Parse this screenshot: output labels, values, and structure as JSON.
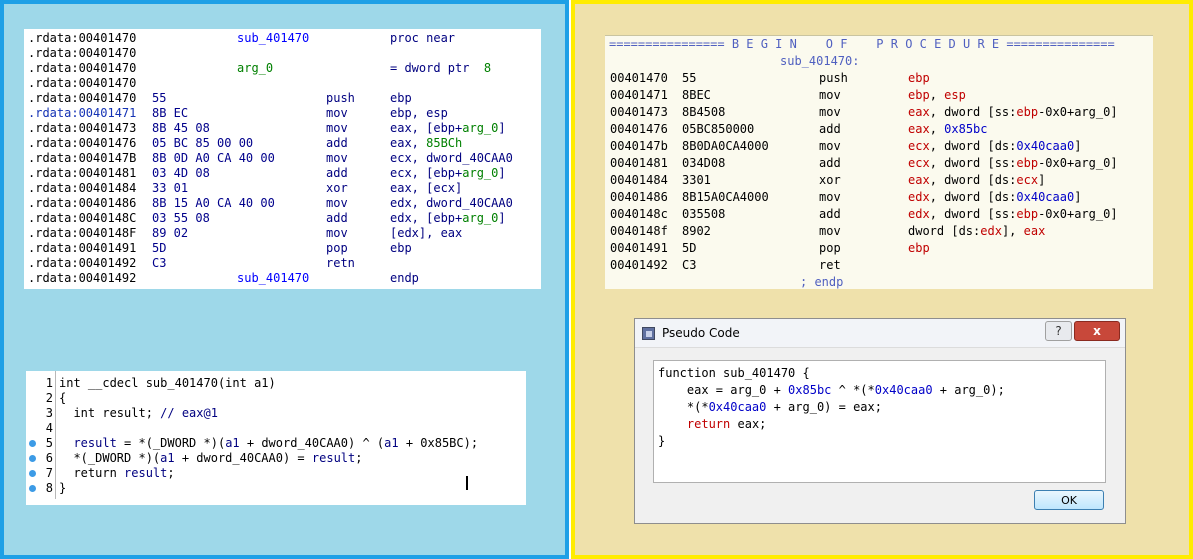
{
  "ida_listing": [
    {
      "addr": ".rdata:00401470",
      "bytes": "",
      "name": "sub_401470",
      "dir": "proc near",
      "mnem": "",
      "ops": []
    },
    {
      "addr": ".rdata:00401470",
      "bytes": "",
      "name": "",
      "dir": "",
      "mnem": "",
      "ops": []
    },
    {
      "addr": ".rdata:00401470",
      "bytes": "",
      "argname": "arg_0",
      "dirops": "= dword ptr  ",
      "dirval": "8"
    },
    {
      "addr": ".rdata:00401470",
      "bytes": "",
      "name": "",
      "dir": "",
      "mnem": "",
      "ops": []
    },
    {
      "addr": ".rdata:00401470",
      "bytes": "55",
      "mnem": "push",
      "ops": [
        {
          "t": "ebp"
        }
      ]
    },
    {
      "addr": ".rdata:00401471",
      "bytes": "8B EC",
      "hl": true,
      "mnem": "mov",
      "ops": [
        {
          "t": "ebp, esp"
        }
      ]
    },
    {
      "addr": ".rdata:00401473",
      "bytes": "8B 45 08",
      "mnem": "mov",
      "ops": [
        {
          "t": "eax, [ebp+"
        },
        {
          "t": "arg_0",
          "g": true
        },
        {
          "t": "]"
        }
      ]
    },
    {
      "addr": ".rdata:00401476",
      "bytes": "05 BC 85 00 00",
      "mnem": "add",
      "ops": [
        {
          "t": "eax, "
        },
        {
          "t": "85BCh",
          "g": true
        }
      ]
    },
    {
      "addr": ".rdata:0040147B",
      "bytes": "8B 0D A0 CA 40 00",
      "mnem": "mov",
      "ops": [
        {
          "t": "ecx, dword_40CAA0"
        }
      ]
    },
    {
      "addr": ".rdata:00401481",
      "bytes": "03 4D 08",
      "mnem": "add",
      "ops": [
        {
          "t": "ecx, [ebp+"
        },
        {
          "t": "arg_0",
          "g": true
        },
        {
          "t": "]"
        }
      ]
    },
    {
      "addr": ".rdata:00401484",
      "bytes": "33 01",
      "mnem": "xor",
      "ops": [
        {
          "t": "eax, [ecx]"
        }
      ]
    },
    {
      "addr": ".rdata:00401486",
      "bytes": "8B 15 A0 CA 40 00",
      "mnem": "mov",
      "ops": [
        {
          "t": "edx, dword_40CAA0"
        }
      ]
    },
    {
      "addr": ".rdata:0040148C",
      "bytes": "03 55 08",
      "mnem": "add",
      "ops": [
        {
          "t": "edx, [ebp+"
        },
        {
          "t": "arg_0",
          "g": true
        },
        {
          "t": "]"
        }
      ]
    },
    {
      "addr": ".rdata:0040148F",
      "bytes": "89 02",
      "mnem": "mov",
      "ops": [
        {
          "t": "[edx], eax"
        }
      ]
    },
    {
      "addr": ".rdata:00401491",
      "bytes": "5D",
      "mnem": "pop",
      "ops": [
        {
          "t": "ebp"
        }
      ]
    },
    {
      "addr": ".rdata:00401492",
      "bytes": "C3",
      "mnem": "retn",
      "ops": []
    },
    {
      "addr": ".rdata:00401492",
      "bytes": "",
      "name": "sub_401470",
      "dir": "endp",
      "mnem": "",
      "ops": []
    }
  ],
  "decompiler": {
    "lines": [
      {
        "num": "1",
        "dot": false,
        "parts": [
          {
            "t": "int __cdecl sub_401470(int a1)"
          }
        ]
      },
      {
        "num": "2",
        "dot": false,
        "parts": [
          {
            "t": "{"
          }
        ]
      },
      {
        "num": "3",
        "dot": false,
        "parts": [
          {
            "t": "  int result; "
          },
          {
            "t": "// eax@1",
            "c": "cm"
          }
        ]
      },
      {
        "num": "4",
        "dot": false,
        "parts": []
      },
      {
        "num": "5",
        "dot": true,
        "parts": [
          {
            "t": "  "
          },
          {
            "t": "result",
            "c": "v"
          },
          {
            "t": " = *(_DWORD *)("
          },
          {
            "t": "a1",
            "c": "v"
          },
          {
            "t": " + dword_40CAA0) ^ ("
          },
          {
            "t": "a1",
            "c": "v"
          },
          {
            "t": " + 0x85BC);"
          }
        ]
      },
      {
        "num": "6",
        "dot": true,
        "parts": [
          {
            "t": "  *(_DWORD *)("
          },
          {
            "t": "a1",
            "c": "v"
          },
          {
            "t": " + dword_40CAA0) = "
          },
          {
            "t": "result",
            "c": "v"
          },
          {
            "t": ";"
          }
        ]
      },
      {
        "num": "7",
        "dot": true,
        "parts": [
          {
            "t": "  return "
          },
          {
            "t": "result",
            "c": "v"
          },
          {
            "t": ";"
          }
        ]
      },
      {
        "num": "8",
        "dot": true,
        "parts": [
          {
            "t": "}"
          }
        ]
      }
    ]
  },
  "listing": {
    "begin": "================ B E G I N    O F    P R O C E D U R E ===============",
    "proc_label": "sub_401470:",
    "rows": [
      {
        "addr": "00401470",
        "bytes": "55",
        "mnem": "push",
        "ops": [
          {
            "t": "ebp",
            "c": "r"
          }
        ]
      },
      {
        "addr": "00401471",
        "bytes": "8BEC",
        "mnem": "mov",
        "ops": [
          {
            "t": "ebp",
            "c": "r"
          },
          {
            "t": ", ",
            "c": "k"
          },
          {
            "t": "esp",
            "c": "r"
          }
        ]
      },
      {
        "addr": "00401473",
        "bytes": "8B4508",
        "mnem": "mov",
        "ops": [
          {
            "t": "eax",
            "c": "r"
          },
          {
            "t": ", dword [ss:",
            "c": "k"
          },
          {
            "t": "ebp",
            "c": "r"
          },
          {
            "t": "-0x0+arg_0]",
            "c": "k"
          }
        ]
      },
      {
        "addr": "00401476",
        "bytes": "05BC850000",
        "mnem": "add",
        "ops": [
          {
            "t": "eax",
            "c": "r"
          },
          {
            "t": ", ",
            "c": "k"
          },
          {
            "t": "0x85bc",
            "c": "n"
          }
        ]
      },
      {
        "addr": "0040147b",
        "bytes": "8B0DA0CA4000",
        "mnem": "mov",
        "ops": [
          {
            "t": "ecx",
            "c": "r"
          },
          {
            "t": ", dword [ds:",
            "c": "k"
          },
          {
            "t": "0x40caa0",
            "c": "n"
          },
          {
            "t": "]",
            "c": "k"
          }
        ]
      },
      {
        "addr": "00401481",
        "bytes": "034D08",
        "mnem": "add",
        "ops": [
          {
            "t": "ecx",
            "c": "r"
          },
          {
            "t": ", dword [ss:",
            "c": "k"
          },
          {
            "t": "ebp",
            "c": "r"
          },
          {
            "t": "-0x0+arg_0]",
            "c": "k"
          }
        ]
      },
      {
        "addr": "00401484",
        "bytes": "3301",
        "mnem": "xor",
        "ops": [
          {
            "t": "eax",
            "c": "r"
          },
          {
            "t": ", dword [ds:",
            "c": "k"
          },
          {
            "t": "ecx",
            "c": "r"
          },
          {
            "t": "]",
            "c": "k"
          }
        ]
      },
      {
        "addr": "00401486",
        "bytes": "8B15A0CA4000",
        "mnem": "mov",
        "ops": [
          {
            "t": "edx",
            "c": "r"
          },
          {
            "t": ", dword [ds:",
            "c": "k"
          },
          {
            "t": "0x40caa0",
            "c": "n"
          },
          {
            "t": "]",
            "c": "k"
          }
        ]
      },
      {
        "addr": "0040148c",
        "bytes": "035508",
        "mnem": "add",
        "ops": [
          {
            "t": "edx",
            "c": "r"
          },
          {
            "t": ", dword [ss:",
            "c": "k"
          },
          {
            "t": "ebp",
            "c": "r"
          },
          {
            "t": "-0x0+arg_0]",
            "c": "k"
          }
        ]
      },
      {
        "addr": "0040148f",
        "bytes": "8902",
        "mnem": "mov",
        "ops": [
          {
            "t": "dword [ds:",
            "c": "k"
          },
          {
            "t": "edx",
            "c": "r"
          },
          {
            "t": "], ",
            "c": "k"
          },
          {
            "t": "eax",
            "c": "r"
          }
        ]
      },
      {
        "addr": "00401491",
        "bytes": "5D",
        "mnem": "pop",
        "ops": [
          {
            "t": "ebp",
            "c": "r"
          }
        ]
      },
      {
        "addr": "00401492",
        "bytes": "C3",
        "mnem": "ret",
        "ops": []
      }
    ],
    "endp": "; endp"
  },
  "dialog": {
    "title": "Pseudo Code",
    "help": "?",
    "close": "x",
    "ok": "OK",
    "code": [
      [
        {
          "t": "function sub_401470 {"
        }
      ],
      [
        {
          "t": "    eax = arg_0 + "
        },
        {
          "t": "0x85bc",
          "c": "n"
        },
        {
          "t": " ^ *(*"
        },
        {
          "t": "0x40caa0",
          "c": "n"
        },
        {
          "t": " + arg_0);"
        }
      ],
      [
        {
          "t": "    *(*"
        },
        {
          "t": "0x40caa0",
          "c": "n"
        },
        {
          "t": " + arg_0) = eax;"
        }
      ],
      [
        {
          "t": "    "
        },
        {
          "t": "return",
          "c": "kw"
        },
        {
          "t": " eax;"
        }
      ],
      [
        {
          "t": "}"
        }
      ]
    ]
  }
}
